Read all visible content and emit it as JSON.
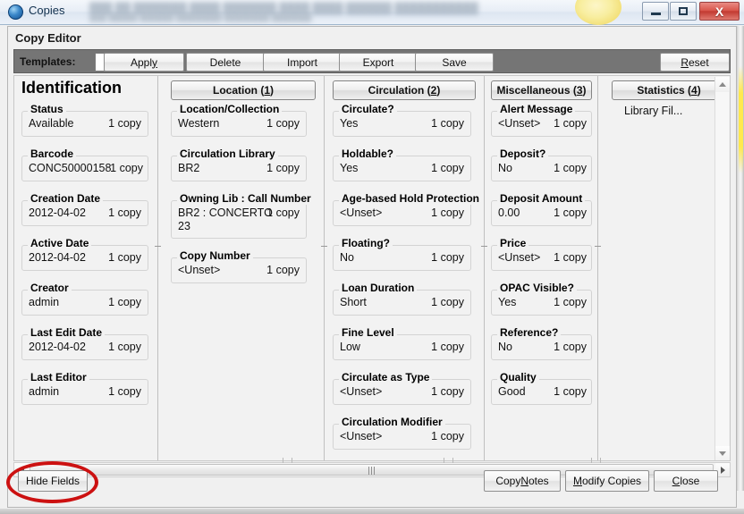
{
  "window": {
    "title": "Copies",
    "blurred_title_text": "",
    "controls": {
      "minimize": "minimize",
      "maximize": "maximize",
      "close": "X"
    }
  },
  "panel": {
    "title": "Copy Editor"
  },
  "toolbar": {
    "templates_label": "Templates:",
    "template_selected": "",
    "buttons": [
      {
        "name": "apply",
        "label": "Appl",
        "accel": "y"
      },
      {
        "name": "delete",
        "label": "Delete",
        "accel": ""
      },
      {
        "name": "import",
        "label": "Import",
        "accel": ""
      },
      {
        "name": "export",
        "label": "Export",
        "accel": ""
      },
      {
        "name": "save",
        "label": "Save",
        "accel": ""
      }
    ],
    "reset": {
      "pre": "",
      "accel": "R",
      "post": "eset"
    }
  },
  "columns": {
    "identification": {
      "heading": "Identification",
      "fields": [
        {
          "label": "Status",
          "value": "Available",
          "count": "1 copy"
        },
        {
          "label": "Barcode",
          "value": "CONC50000158",
          "count": "1 copy"
        },
        {
          "label": "Creation Date",
          "value": "2012-04-02",
          "count": "1 copy"
        },
        {
          "label": "Active Date",
          "value": "2012-04-02",
          "count": "1 copy"
        },
        {
          "label": "Creator",
          "value": "admin",
          "count": "1 copy"
        },
        {
          "label": "Last Edit Date",
          "value": "2012-04-02",
          "count": "1 copy"
        },
        {
          "label": "Last Editor",
          "value": "admin",
          "count": "1 copy"
        }
      ]
    },
    "location": {
      "heading": "Location (1)",
      "heading_text": "Location (",
      "heading_accel": "1",
      "heading_tail": ")",
      "fields": [
        {
          "label": "Location/Collection",
          "value": "Western",
          "count": "1 copy"
        },
        {
          "label": "Circulation Library",
          "value": "BR2",
          "count": "1 copy"
        },
        {
          "label": "Owning Lib : Call Number",
          "value": "BR2 : CONCERTO",
          "value2": "23",
          "count": "1 copy"
        },
        {
          "label": "Copy Number",
          "value": "<Unset>",
          "count": "1 copy"
        }
      ]
    },
    "circulation": {
      "heading": "Circulation (2)",
      "heading_text": "Circulation (",
      "heading_accel": "2",
      "heading_tail": ")",
      "fields": [
        {
          "label": "Circulate?",
          "value": "Yes",
          "count": "1 copy"
        },
        {
          "label": "Holdable?",
          "value": "Yes",
          "count": "1 copy"
        },
        {
          "label": "Age-based Hold Protection",
          "value": "<Unset>",
          "count": "1 copy"
        },
        {
          "label": "Floating?",
          "value": "No",
          "count": "1 copy"
        },
        {
          "label": "Loan Duration",
          "value": "Short",
          "count": "1 copy"
        },
        {
          "label": "Fine Level",
          "value": "Low",
          "count": "1 copy"
        },
        {
          "label": "Circulate as Type",
          "value": "<Unset>",
          "count": "1 copy"
        },
        {
          "label": "Circulation Modifier",
          "value": "<Unset>",
          "count": "1 copy"
        }
      ]
    },
    "miscellaneous": {
      "heading": "Miscellaneous (3)",
      "heading_text": "Miscellaneous (",
      "heading_accel": "3",
      "heading_tail": ")",
      "fields": [
        {
          "label": "Alert Message",
          "value": "<Unset>",
          "count": "1 copy"
        },
        {
          "label": "Deposit?",
          "value": "No",
          "count": "1 copy"
        },
        {
          "label": "Deposit Amount",
          "value": "0.00",
          "count": "1 copy"
        },
        {
          "label": "Price",
          "value": "<Unset>",
          "count": "1 copy"
        },
        {
          "label": "OPAC Visible?",
          "value": "Yes",
          "count": "1 copy"
        },
        {
          "label": "Reference?",
          "value": "No",
          "count": "1 copy"
        },
        {
          "label": "Quality",
          "value": "Good",
          "count": "1 copy"
        }
      ]
    },
    "statistics": {
      "heading": "Statistics (4)",
      "heading_text": "Statistics (",
      "heading_accel": "4",
      "heading_tail": ")",
      "rows": [
        {
          "label": "Library Fil...",
          "has_submenu": true
        }
      ]
    }
  },
  "footer": {
    "hide_fields": "Hide Fields",
    "copy_notes_pre": "Copy ",
    "copy_notes_accel": "N",
    "copy_notes_post": "otes",
    "modify_copies_pre": "",
    "modify_copies_accel": "M",
    "modify_copies_post": "odify Copies",
    "close_pre": "",
    "close_accel": "C",
    "close_post": "lose"
  },
  "annotation": {
    "shape": "ellipse",
    "color": "#cc1111",
    "target": "Hide Fields"
  }
}
